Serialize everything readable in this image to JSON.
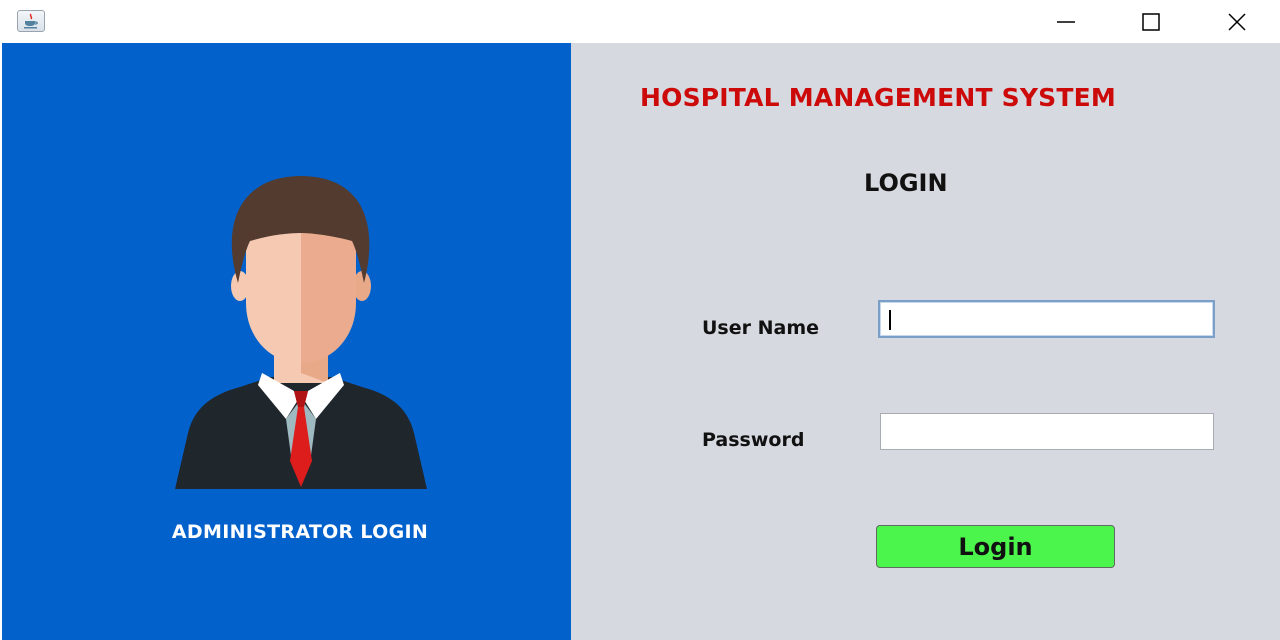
{
  "window": {
    "icons": {
      "app": "java-cup-icon",
      "minimize": "minimize-icon",
      "maximize": "maximize-icon",
      "close": "close-icon"
    }
  },
  "left_panel": {
    "background": "#0361cc",
    "avatar_icon": "administrator-avatar-icon",
    "caption": "ADMINISTRATOR LOGIN"
  },
  "right_panel": {
    "background": "#d6d9e0",
    "app_title": "HOSPITAL MANAGEMENT SYSTEM",
    "app_title_color": "#cc0a0a",
    "heading": "LOGIN",
    "username": {
      "label": "User Name",
      "value": ""
    },
    "password": {
      "label": "Password",
      "value": ""
    },
    "login_button": {
      "label": "Login",
      "color": "#4cf54c"
    }
  }
}
